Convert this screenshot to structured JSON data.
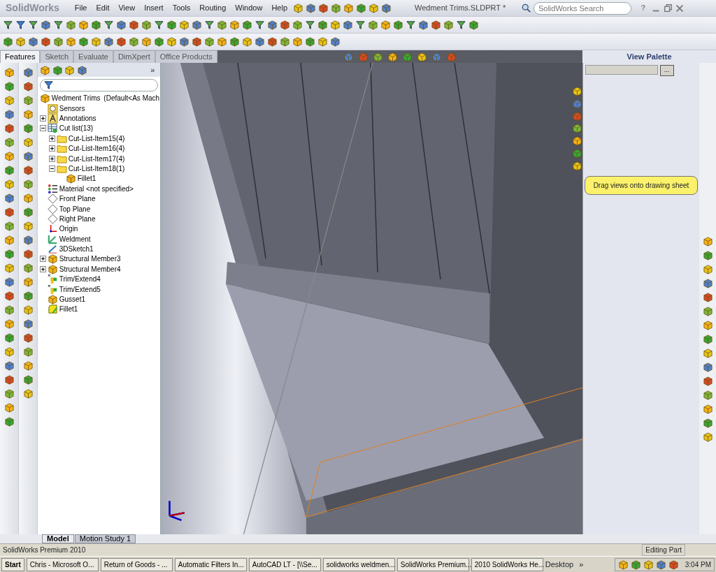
{
  "app": {
    "logo": "SolidWorks",
    "menu": [
      "File",
      "Edit",
      "View",
      "Insert",
      "Tools",
      "Routing",
      "Window",
      "Help"
    ],
    "title": "Wedment Trims.SLDPRT *",
    "search": {
      "placeholder": "SolidWorks Search"
    },
    "help": "?"
  },
  "command_tabs": [
    {
      "label": "Features",
      "selected": true
    },
    {
      "label": "Sketch",
      "selected": false
    },
    {
      "label": "Evaluate",
      "selected": false
    },
    {
      "label": "DimXpert",
      "selected": false
    },
    {
      "label": "Office Products",
      "selected": false
    }
  ],
  "feature_tree": {
    "more": "»",
    "root": {
      "label": "Wedment Trims",
      "configuration": "(Default<As Mach"
    },
    "items": [
      {
        "label": "Sensors",
        "kind": "sensor"
      },
      {
        "label": "Annotations",
        "kind": "annotation",
        "expanded": false
      },
      {
        "label": "Cut list(13)",
        "kind": "cutlist",
        "expanded": true,
        "children": [
          {
            "label": "Cut-List-Item15(4)",
            "kind": "folder",
            "expanded": false
          },
          {
            "label": "Cut-List-Item16(4)",
            "kind": "folder",
            "expanded": false
          },
          {
            "label": "Cut-List-Item17(4)",
            "kind": "folder",
            "expanded": false
          },
          {
            "label": "Cut-List-Item18(1)",
            "kind": "folder",
            "expanded": true,
            "children": [
              {
                "label": "Fillet1",
                "kind": "feature"
              }
            ]
          }
        ]
      },
      {
        "label": "Material <not specified>",
        "kind": "material"
      },
      {
        "label": "Front Plane",
        "kind": "plane"
      },
      {
        "label": "Top Plane",
        "kind": "plane"
      },
      {
        "label": "Right Plane",
        "kind": "plane"
      },
      {
        "label": "Origin",
        "kind": "origin"
      },
      {
        "label": "Weldment",
        "kind": "weldment"
      },
      {
        "label": "3DSketch1",
        "kind": "sketch"
      },
      {
        "label": "Structural Member3",
        "kind": "feature",
        "expanded": false
      },
      {
        "label": "Structural Member4",
        "kind": "feature",
        "expanded": false
      },
      {
        "label": "Trim/Extend4",
        "kind": "trim"
      },
      {
        "label": "Trim/Extend5",
        "kind": "trim"
      },
      {
        "label": "Gusset1",
        "kind": "feature"
      },
      {
        "label": "Fillet1",
        "kind": "fillet"
      }
    ]
  },
  "view_palette": {
    "title": "View Palette",
    "browse": "...",
    "hint": "Drag views onto drawing sheet"
  },
  "bottom_tabs": [
    {
      "label": "Model",
      "selected": true
    },
    {
      "label": "Motion Study 1",
      "selected": false
    }
  ],
  "status_bar": {
    "product": "SolidWorks Premium 2010",
    "mode": "Editing Part"
  },
  "taskbar": {
    "start": "Start",
    "buttons": [
      "Chris - Microsoft O...",
      "Return of Goods - ...",
      "Automatic Filters In...",
      "AutoCAD LT - [\\\\Se...",
      "solidworks weldmen...",
      "SolidWorks Premium...",
      "2010 SolidWorks He..."
    ],
    "desktop": "Desktop",
    "more": "»",
    "clock": "3:04 PM"
  }
}
